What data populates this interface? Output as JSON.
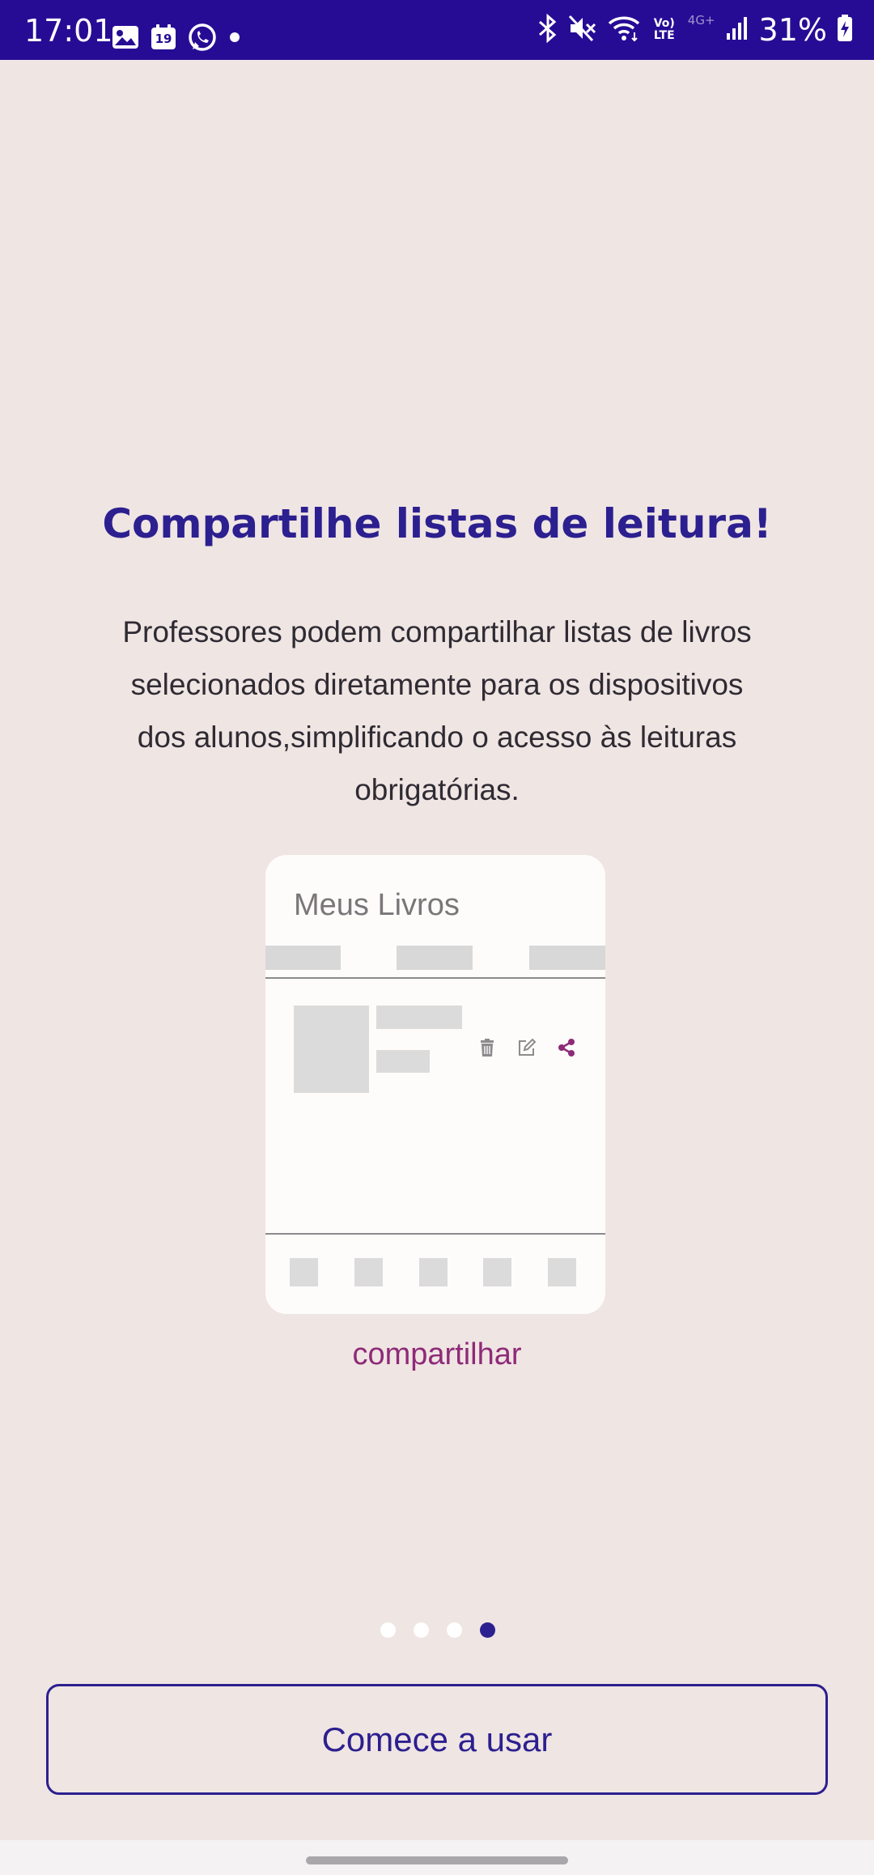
{
  "status_bar": {
    "time": "17:01",
    "calendar_day": "19",
    "battery": "31%",
    "left_icons": [
      "image-icon",
      "calendar-icon",
      "whatsapp-icon",
      "notification-dot-icon"
    ],
    "right_icons": [
      "bluetooth-icon",
      "mute-icon",
      "wifi-icon",
      "volte-icon",
      "4g-icon",
      "signal-icon",
      "battery-charging-icon"
    ],
    "network_label": "4G+",
    "volte_label": "Vo) LTE",
    "background_color": "#260c95"
  },
  "onboarding": {
    "title": "Compartilhe listas de leitura!",
    "description": "Professores podem compartilhar listas de livros selecionados diretamente para os dispositivos dos alunos,simplificando o acesso às leituras obrigatórias.",
    "illustration": {
      "header": "Meus Livros",
      "actions": [
        "trash-icon",
        "edit-icon",
        "share-icon"
      ]
    },
    "caption": "compartilhar",
    "pager": {
      "total": 4,
      "active_index": 3
    },
    "cta_label": "Comece a usar"
  },
  "colors": {
    "accent": "#2c1f8f",
    "caption": "#8e2a78",
    "background": "#efe5e3"
  }
}
